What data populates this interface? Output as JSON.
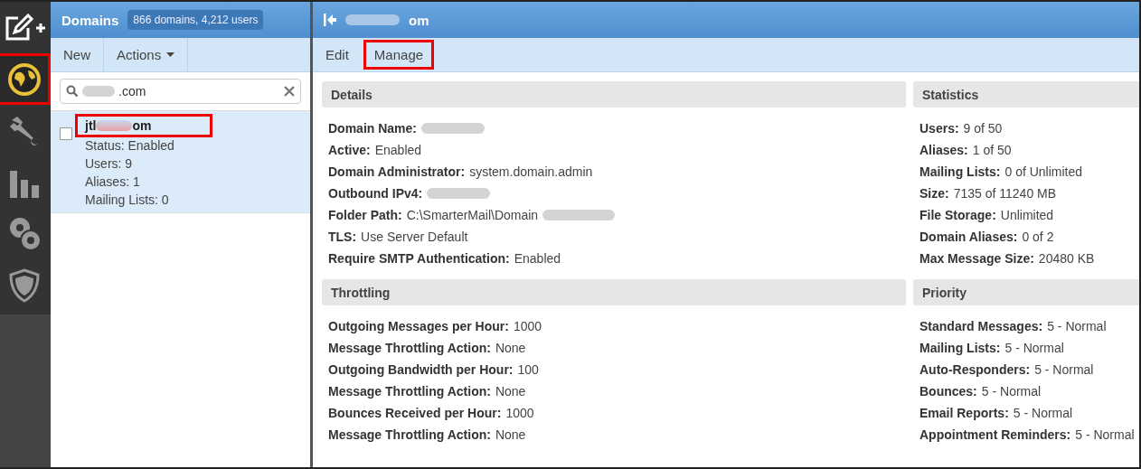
{
  "nav": [
    {
      "selected": false
    },
    {
      "selected": true
    },
    {
      "selected": false
    },
    {
      "selected": false
    },
    {
      "selected": false
    },
    {
      "selected": false
    }
  ],
  "domains_panel": {
    "title": "Domains",
    "count": "866 domains, 4,212 users",
    "toolbar": [
      {
        "label": "New",
        "kind": "button"
      },
      {
        "label": "Actions",
        "kind": "dropdown"
      }
    ],
    "search": {
      "value": ".com",
      "redacted": true
    },
    "items": [
      {
        "name_start": "jtl",
        "name_end": "om",
        "redacted": true,
        "highlighted": true,
        "selected": true,
        "checked": false,
        "lines": [
          "Status: Enabled",
          "Users: 9",
          "Aliases: 1",
          "Mailing Lists: 0"
        ]
      }
    ]
  },
  "detail_panel": {
    "title": "om",
    "title_redacted": true,
    "tabs": [
      {
        "label": "Edit",
        "highlighted": false
      },
      {
        "label": "Manage",
        "highlighted": true
      }
    ],
    "sections": [
      {
        "title": "Details",
        "rows": [
          {
            "label": "Domain Name:",
            "redacted": true
          },
          {
            "label": "Active:",
            "value": "Enabled"
          },
          {
            "label": "Domain Administrator:",
            "value": "system.domain.admin"
          },
          {
            "label": "Outbound IPv4:",
            "redacted": true
          },
          {
            "label": "Folder Path:",
            "value": "C:\\SmarterMail\\Domain",
            "redacted": true
          },
          {
            "label": "TLS:",
            "value": "Use Server Default"
          },
          {
            "label": "Require SMTP Authentication:",
            "value": "Enabled"
          }
        ]
      },
      {
        "title": "Statistics",
        "rows": [
          {
            "label": "Users:",
            "value": "9 of 50"
          },
          {
            "label": "Aliases:",
            "value": "1 of 50"
          },
          {
            "label": "Mailing Lists:",
            "value": "0 of Unlimited"
          },
          {
            "label": "Size:",
            "value": "7135 of 11240 MB"
          },
          {
            "label": "File Storage:",
            "value": "Unlimited"
          },
          {
            "label": "Domain Aliases:",
            "value": "0 of 2"
          },
          {
            "label": "Max Message Size:",
            "value": "20480 KB"
          }
        ]
      },
      {
        "title": "Throttling",
        "rows": [
          {
            "label": "Outgoing Messages per Hour:",
            "value": "1000"
          },
          {
            "label": "Message Throttling Action:",
            "value": "None"
          },
          {
            "label": "Outgoing Bandwidth per Hour:",
            "value": "100"
          },
          {
            "label": "Message Throttling Action:",
            "value": "None"
          },
          {
            "label": "Bounces Received per Hour:",
            "value": "1000"
          },
          {
            "label": "Message Throttling Action:",
            "value": "None"
          }
        ]
      },
      {
        "title": "Priority",
        "rows": [
          {
            "label": "Standard Messages:",
            "value": "5 - Normal"
          },
          {
            "label": "Mailing Lists:",
            "value": "5 - Normal"
          },
          {
            "label": "Auto-Responders:",
            "value": "5 - Normal"
          },
          {
            "label": "Bounces:",
            "value": "5 - Normal"
          },
          {
            "label": "Email Reports:",
            "value": "5 - Normal"
          },
          {
            "label": "Appointment Reminders:",
            "value": "5 - Normal"
          }
        ]
      }
    ]
  }
}
